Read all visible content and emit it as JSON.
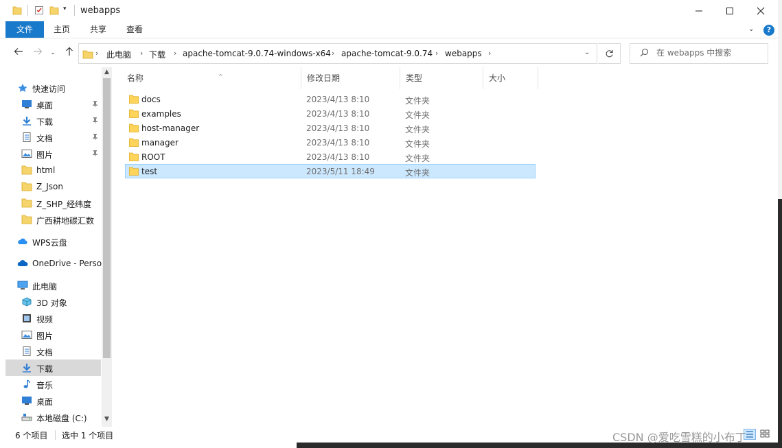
{
  "window": {
    "title": "webapps"
  },
  "ribbon": {
    "tabs": [
      "文件",
      "主页",
      "共享",
      "查看"
    ]
  },
  "address": {
    "breadcrumbs": [
      "此电脑",
      "下载",
      "apache-tomcat-9.0.74-windows-x64",
      "apache-tomcat-9.0.74",
      "webapps"
    ],
    "search_placeholder": "在 webapps 中搜索"
  },
  "nav": {
    "items": [
      {
        "label": "快速访问",
        "icon": "star-icon"
      },
      {
        "label": "桌面",
        "icon": "desktop-icon",
        "pinned": true
      },
      {
        "label": "下载",
        "icon": "download-icon",
        "pinned": true
      },
      {
        "label": "文档",
        "icon": "document-icon",
        "pinned": true
      },
      {
        "label": "图片",
        "icon": "picture-icon",
        "pinned": true
      },
      {
        "label": "html",
        "icon": "folder-icon"
      },
      {
        "label": "Z_Json",
        "icon": "folder-icon"
      },
      {
        "label": "Z_SHP_经纬度",
        "icon": "folder-icon"
      },
      {
        "label": "广西耕地碳汇数",
        "icon": "folder-icon"
      },
      {
        "label": "WPS云盘",
        "icon": "cloud-icon"
      },
      {
        "label": "OneDrive - Perso",
        "icon": "onedrive-icon"
      },
      {
        "label": "此电脑",
        "icon": "computer-icon"
      },
      {
        "label": "3D 对象",
        "icon": "cube-icon"
      },
      {
        "label": "视频",
        "icon": "video-icon"
      },
      {
        "label": "图片",
        "icon": "picture-icon"
      },
      {
        "label": "文档",
        "icon": "document-icon"
      },
      {
        "label": "下载",
        "icon": "download-icon",
        "selected": true
      },
      {
        "label": "音乐",
        "icon": "music-icon"
      },
      {
        "label": "桌面",
        "icon": "desktop-icon"
      },
      {
        "label": "本地磁盘 (C:)",
        "icon": "drive-icon"
      }
    ]
  },
  "columns": {
    "name": "名称",
    "modified": "修改日期",
    "type": "类型",
    "size": "大小"
  },
  "files": [
    {
      "name": "docs",
      "modified": "2023/4/13 8:10",
      "type": "文件夹"
    },
    {
      "name": "examples",
      "modified": "2023/4/13 8:10",
      "type": "文件夹"
    },
    {
      "name": "host-manager",
      "modified": "2023/4/13 8:10",
      "type": "文件夹"
    },
    {
      "name": "manager",
      "modified": "2023/4/13 8:10",
      "type": "文件夹"
    },
    {
      "name": "ROOT",
      "modified": "2023/4/13 8:10",
      "type": "文件夹"
    },
    {
      "name": "test",
      "modified": "2023/5/11 18:49",
      "type": "文件夹",
      "selected": true
    }
  ],
  "status": {
    "item_count": "6 个项目",
    "selected_count": "选中 1 个项目"
  },
  "watermark": "CSDN @爱吃雪糕的小布丁",
  "colors": {
    "accent": "#1979ca",
    "selection": "#cce8ff",
    "folder": "#ffd45a"
  }
}
